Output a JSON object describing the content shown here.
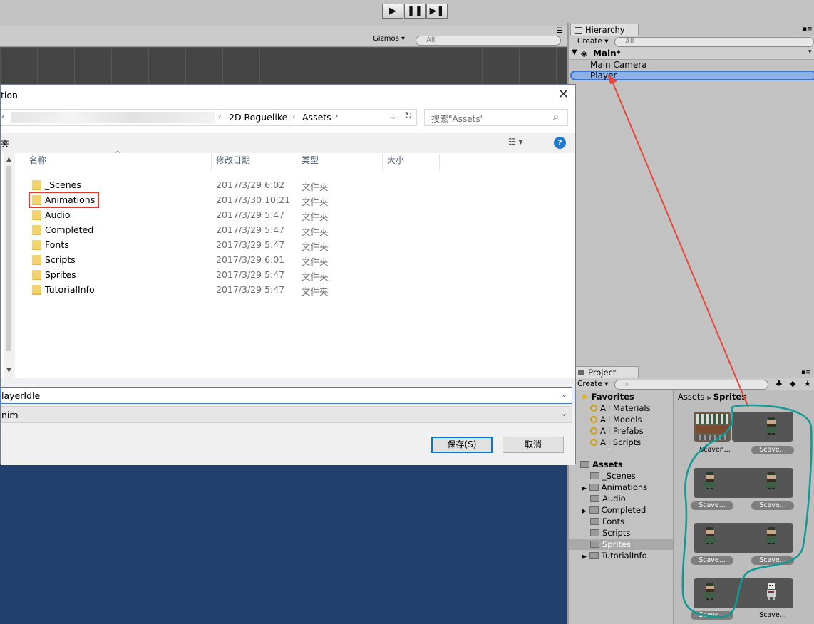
{
  "toolbar": {
    "play_icon": "play-icon",
    "pause_icon": "pause-icon",
    "step_icon": "step-icon"
  },
  "scene": {
    "gizmos_label": "Gizmos",
    "search_placeholder": "All"
  },
  "hierarchy": {
    "tab_label": "Hierarchy",
    "create_label": "Create",
    "search_placeholder": "All",
    "scene_name": "Main*",
    "items": [
      "Main Camera",
      "Player"
    ]
  },
  "dialog": {
    "title_fragment": "tion",
    "breadcrumb": [
      "2D Roguelike",
      "Assets"
    ],
    "search_placeholder": "搜索\"Assets\"",
    "left_fragment": "夹",
    "columns": {
      "name": "名称",
      "date": "修改日期",
      "type": "类型",
      "size": "大小"
    },
    "files": [
      {
        "name": "_Scenes",
        "date": "2017/3/29 6:02",
        "type": "文件夹"
      },
      {
        "name": "Animations",
        "date": "2017/3/30 10:21",
        "type": "文件夹"
      },
      {
        "name": "Audio",
        "date": "2017/3/29 5:47",
        "type": "文件夹"
      },
      {
        "name": "Completed",
        "date": "2017/3/29 5:47",
        "type": "文件夹"
      },
      {
        "name": "Fonts",
        "date": "2017/3/29 5:47",
        "type": "文件夹"
      },
      {
        "name": "Scripts",
        "date": "2017/3/29 6:01",
        "type": "文件夹"
      },
      {
        "name": "Sprites",
        "date": "2017/3/29 5:47",
        "type": "文件夹"
      },
      {
        "name": "TutorialInfo",
        "date": "2017/3/29 5:47",
        "type": "文件夹"
      }
    ],
    "filename_value": "layerIdle",
    "filetype_value": "nim",
    "save_label": "保存(S)",
    "cancel_label": "取消"
  },
  "project": {
    "tab_label": "Project",
    "create_label": "Create",
    "favorites_label": "Favorites",
    "favorites": [
      "All Materials",
      "All Models",
      "All Prefabs",
      "All Scripts"
    ],
    "assets_label": "Assets",
    "asset_folders": [
      "_Scenes",
      "Animations",
      "Audio",
      "Completed",
      "Fonts",
      "Scripts",
      "Sprites",
      "TutorialInfo"
    ],
    "breadcrumb_root": "Assets",
    "breadcrumb_current": "Sprites",
    "captions": [
      "Scaven...",
      "Scave...",
      "Scave...",
      "Scave...",
      "Scave...",
      "Scave...",
      "Scave...",
      "Scave..."
    ]
  },
  "colors": {
    "selection_blue": "#3a72d8",
    "scene_blue": "#233f6e",
    "highlight_red": "#e03a2f",
    "annotation_teal": "#0f9a93",
    "arrow_red": "#e8463a"
  }
}
